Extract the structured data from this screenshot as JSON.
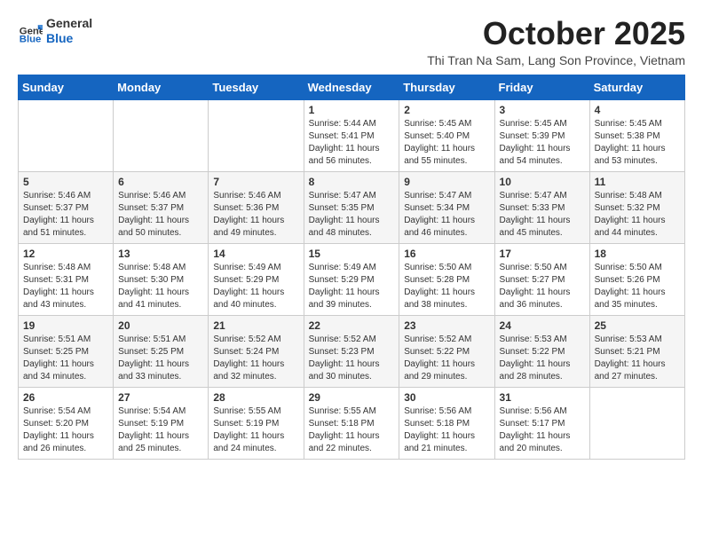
{
  "logo": {
    "general": "General",
    "blue": "Blue"
  },
  "header": {
    "month": "October 2025",
    "location": "Thi Tran Na Sam, Lang Son Province, Vietnam"
  },
  "weekdays": [
    "Sunday",
    "Monday",
    "Tuesday",
    "Wednesday",
    "Thursday",
    "Friday",
    "Saturday"
  ],
  "weeks": [
    [
      {
        "day": "",
        "info": ""
      },
      {
        "day": "",
        "info": ""
      },
      {
        "day": "",
        "info": ""
      },
      {
        "day": "1",
        "info": "Sunrise: 5:44 AM\nSunset: 5:41 PM\nDaylight: 11 hours and 56 minutes."
      },
      {
        "day": "2",
        "info": "Sunrise: 5:45 AM\nSunset: 5:40 PM\nDaylight: 11 hours and 55 minutes."
      },
      {
        "day": "3",
        "info": "Sunrise: 5:45 AM\nSunset: 5:39 PM\nDaylight: 11 hours and 54 minutes."
      },
      {
        "day": "4",
        "info": "Sunrise: 5:45 AM\nSunset: 5:38 PM\nDaylight: 11 hours and 53 minutes."
      }
    ],
    [
      {
        "day": "5",
        "info": "Sunrise: 5:46 AM\nSunset: 5:37 PM\nDaylight: 11 hours and 51 minutes."
      },
      {
        "day": "6",
        "info": "Sunrise: 5:46 AM\nSunset: 5:37 PM\nDaylight: 11 hours and 50 minutes."
      },
      {
        "day": "7",
        "info": "Sunrise: 5:46 AM\nSunset: 5:36 PM\nDaylight: 11 hours and 49 minutes."
      },
      {
        "day": "8",
        "info": "Sunrise: 5:47 AM\nSunset: 5:35 PM\nDaylight: 11 hours and 48 minutes."
      },
      {
        "day": "9",
        "info": "Sunrise: 5:47 AM\nSunset: 5:34 PM\nDaylight: 11 hours and 46 minutes."
      },
      {
        "day": "10",
        "info": "Sunrise: 5:47 AM\nSunset: 5:33 PM\nDaylight: 11 hours and 45 minutes."
      },
      {
        "day": "11",
        "info": "Sunrise: 5:48 AM\nSunset: 5:32 PM\nDaylight: 11 hours and 44 minutes."
      }
    ],
    [
      {
        "day": "12",
        "info": "Sunrise: 5:48 AM\nSunset: 5:31 PM\nDaylight: 11 hours and 43 minutes."
      },
      {
        "day": "13",
        "info": "Sunrise: 5:48 AM\nSunset: 5:30 PM\nDaylight: 11 hours and 41 minutes."
      },
      {
        "day": "14",
        "info": "Sunrise: 5:49 AM\nSunset: 5:29 PM\nDaylight: 11 hours and 40 minutes."
      },
      {
        "day": "15",
        "info": "Sunrise: 5:49 AM\nSunset: 5:29 PM\nDaylight: 11 hours and 39 minutes."
      },
      {
        "day": "16",
        "info": "Sunrise: 5:50 AM\nSunset: 5:28 PM\nDaylight: 11 hours and 38 minutes."
      },
      {
        "day": "17",
        "info": "Sunrise: 5:50 AM\nSunset: 5:27 PM\nDaylight: 11 hours and 36 minutes."
      },
      {
        "day": "18",
        "info": "Sunrise: 5:50 AM\nSunset: 5:26 PM\nDaylight: 11 hours and 35 minutes."
      }
    ],
    [
      {
        "day": "19",
        "info": "Sunrise: 5:51 AM\nSunset: 5:25 PM\nDaylight: 11 hours and 34 minutes."
      },
      {
        "day": "20",
        "info": "Sunrise: 5:51 AM\nSunset: 5:25 PM\nDaylight: 11 hours and 33 minutes."
      },
      {
        "day": "21",
        "info": "Sunrise: 5:52 AM\nSunset: 5:24 PM\nDaylight: 11 hours and 32 minutes."
      },
      {
        "day": "22",
        "info": "Sunrise: 5:52 AM\nSunset: 5:23 PM\nDaylight: 11 hours and 30 minutes."
      },
      {
        "day": "23",
        "info": "Sunrise: 5:52 AM\nSunset: 5:22 PM\nDaylight: 11 hours and 29 minutes."
      },
      {
        "day": "24",
        "info": "Sunrise: 5:53 AM\nSunset: 5:22 PM\nDaylight: 11 hours and 28 minutes."
      },
      {
        "day": "25",
        "info": "Sunrise: 5:53 AM\nSunset: 5:21 PM\nDaylight: 11 hours and 27 minutes."
      }
    ],
    [
      {
        "day": "26",
        "info": "Sunrise: 5:54 AM\nSunset: 5:20 PM\nDaylight: 11 hours and 26 minutes."
      },
      {
        "day": "27",
        "info": "Sunrise: 5:54 AM\nSunset: 5:19 PM\nDaylight: 11 hours and 25 minutes."
      },
      {
        "day": "28",
        "info": "Sunrise: 5:55 AM\nSunset: 5:19 PM\nDaylight: 11 hours and 24 minutes."
      },
      {
        "day": "29",
        "info": "Sunrise: 5:55 AM\nSunset: 5:18 PM\nDaylight: 11 hours and 22 minutes."
      },
      {
        "day": "30",
        "info": "Sunrise: 5:56 AM\nSunset: 5:18 PM\nDaylight: 11 hours and 21 minutes."
      },
      {
        "day": "31",
        "info": "Sunrise: 5:56 AM\nSunset: 5:17 PM\nDaylight: 11 hours and 20 minutes."
      },
      {
        "day": "",
        "info": ""
      }
    ]
  ]
}
